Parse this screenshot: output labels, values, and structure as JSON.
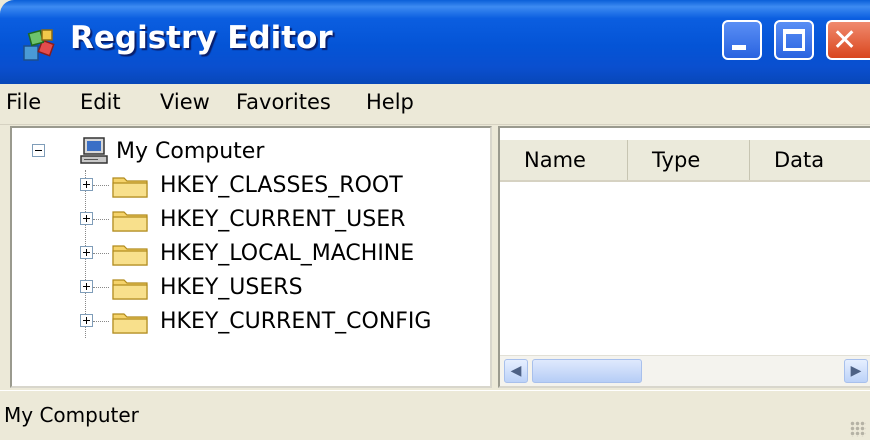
{
  "window": {
    "title": "Registry Editor",
    "title_icon": "registry-editor-icon",
    "controls": [
      "minimize-icon",
      "maximize-icon",
      "close-icon"
    ]
  },
  "menu": {
    "items": [
      "File",
      "Edit",
      "View",
      "Favorites",
      "Help"
    ]
  },
  "tree": {
    "root": {
      "label": "My Computer",
      "icon": "computer-icon",
      "expanded": true
    },
    "children": [
      {
        "label": "HKEY_CLASSES_ROOT",
        "icon": "folder-icon",
        "expanded": false
      },
      {
        "label": "HKEY_CURRENT_USER",
        "icon": "folder-icon",
        "expanded": false
      },
      {
        "label": "HKEY_LOCAL_MACHINE",
        "icon": "folder-icon",
        "expanded": false
      },
      {
        "label": "HKEY_USERS",
        "icon": "folder-icon",
        "expanded": false
      },
      {
        "label": "HKEY_CURRENT_CONFIG",
        "icon": "folder-icon",
        "expanded": false
      }
    ]
  },
  "list": {
    "columns": [
      "Name",
      "Type",
      "Data"
    ],
    "rows": []
  },
  "status": {
    "text": "My Computer"
  },
  "colors": {
    "titlebar": "#0454d6",
    "chrome": "#ece9d8",
    "close_button": "#d9461e",
    "folder": "#f5d36b"
  }
}
